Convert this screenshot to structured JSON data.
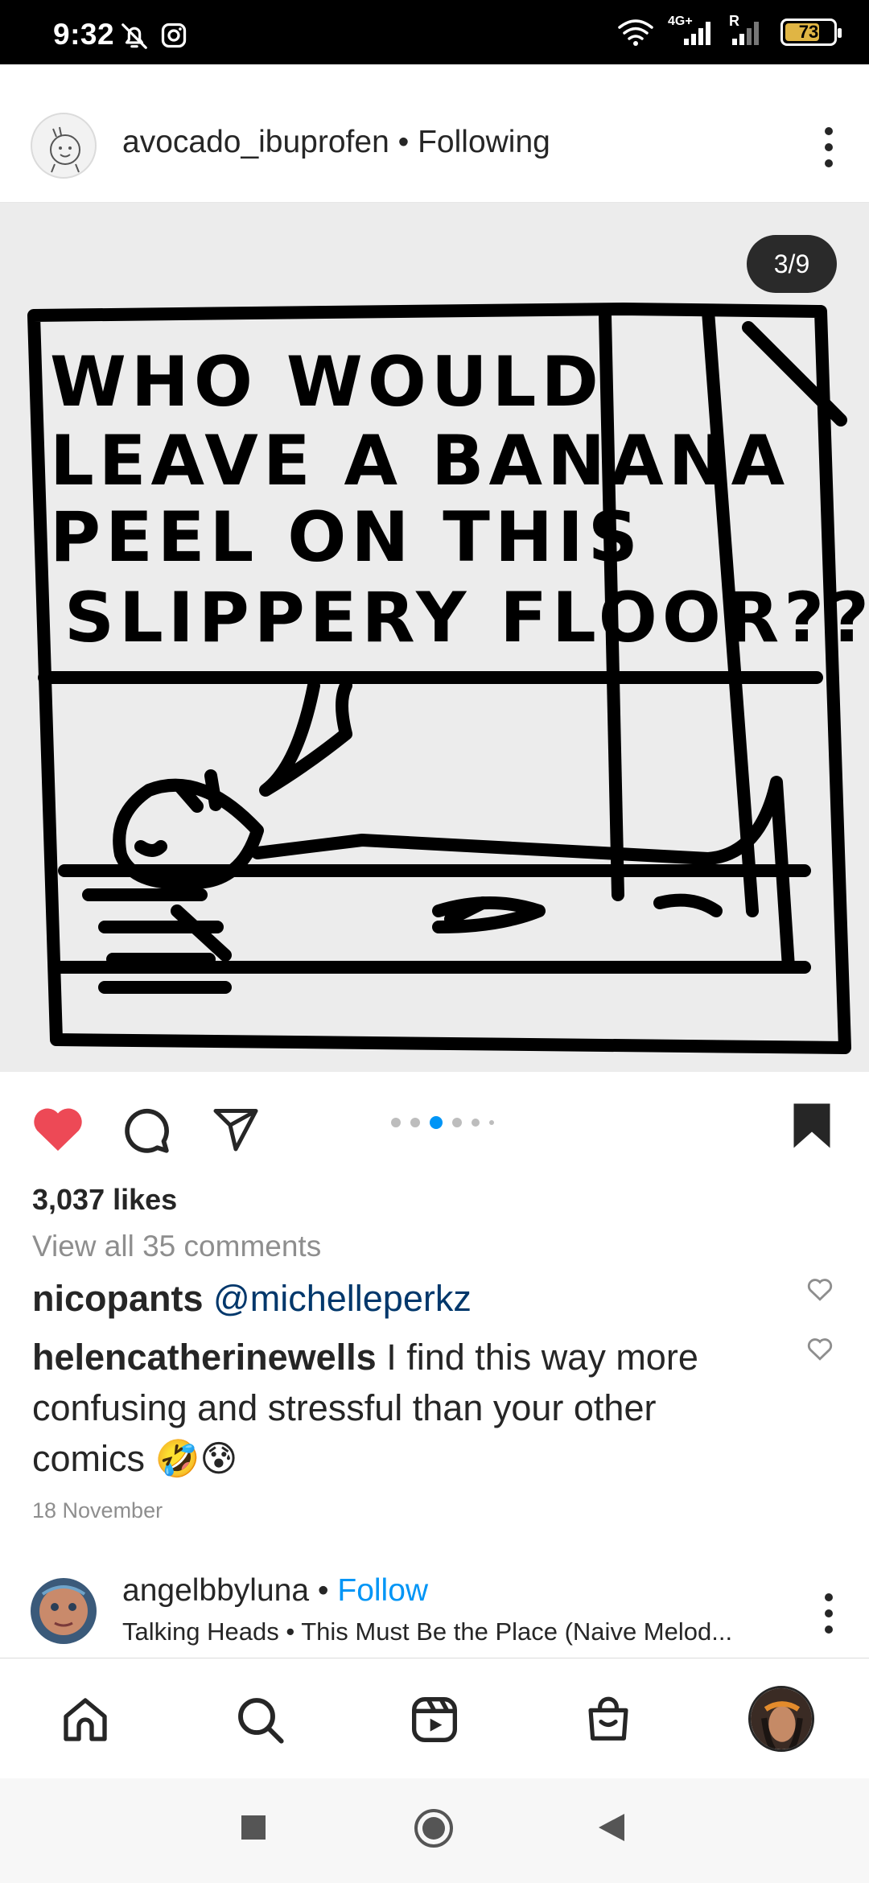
{
  "status_bar": {
    "time": "9:32",
    "network": "4G+",
    "sim2_label": "R",
    "battery": "73",
    "battery_level": 0.73,
    "icons": [
      "bell-off-icon",
      "instagram-icon",
      "wifi-icon",
      "signal-icon",
      "battery-icon"
    ]
  },
  "post": {
    "username": "avocado_ibuprofen",
    "separator": " • ",
    "follow_state": "Following",
    "slide_counter": "3/9",
    "comic_text": [
      "WHO WOULD",
      "LEAVE A BANANA",
      "PEEL ON THIS",
      "SLIPPERY FLOOR??"
    ],
    "carousel": {
      "total_dots": 6,
      "active_index": 2
    },
    "likes": "3,037 likes",
    "view_all_comments": "View all 35 comments",
    "comments": [
      {
        "user": "nicopants",
        "text": "@michelleperkz"
      },
      {
        "user": "helencatherinewells",
        "text": "I find this way more confusing and stressful than your other comics 🤣😰"
      }
    ],
    "date": "18 November"
  },
  "next_post": {
    "username": "angelbbyluna",
    "separator": " • ",
    "follow": "Follow",
    "audio": "Talking Heads • This Must Be the Place (Naive Melod..."
  },
  "bottom_nav": {
    "items": [
      "home-icon",
      "search-icon",
      "reels-icon",
      "shop-icon",
      "profile-avatar"
    ]
  },
  "colors": {
    "like_red": "#ed4956",
    "follow_blue": "#0095f6",
    "mention_blue": "#00376b",
    "muted": "#8e8e8e"
  }
}
